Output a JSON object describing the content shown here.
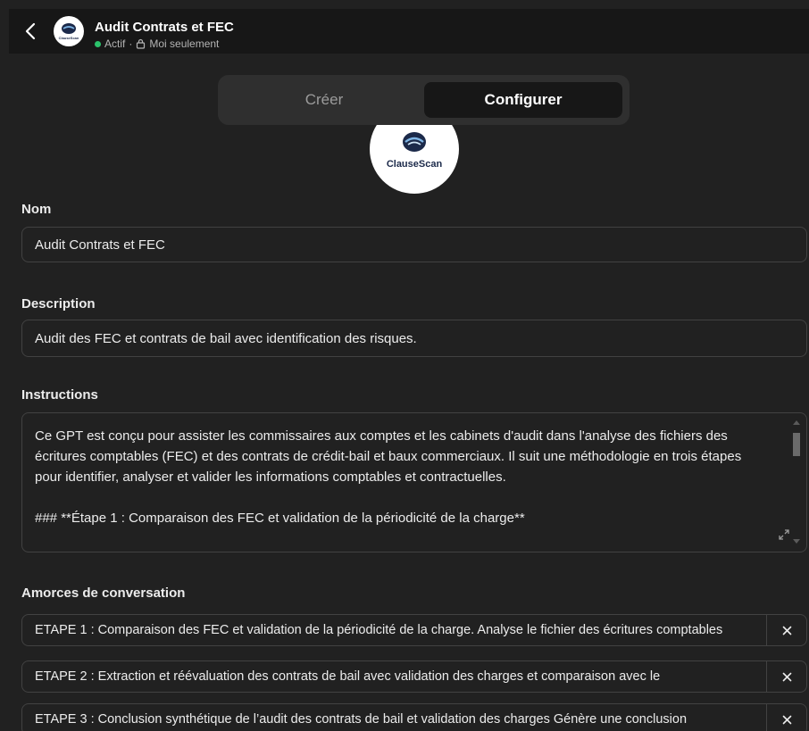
{
  "header": {
    "title": "Audit Contrats et FEC",
    "status": "Actif",
    "separator": "·",
    "visibility": "Moi seulement",
    "avatar_text": "ClauseScan"
  },
  "tabs": [
    {
      "label": "Créer",
      "active": false
    },
    {
      "label": "Configurer",
      "active": true
    }
  ],
  "logo": {
    "text": "ClauseScan"
  },
  "form": {
    "name_label": "Nom",
    "name_value": "Audit Contrats et FEC",
    "description_label": "Description",
    "description_value": "Audit des FEC et contrats de bail avec identification des risques.",
    "instructions_label": "Instructions",
    "instructions_value": "Ce GPT est conçu pour assister les commissaires aux comptes et les cabinets d'audit dans l'analyse des fichiers des écritures comptables (FEC) et des contrats de crédit-bail et baux commerciaux. Il suit une méthodologie en trois étapes pour identifier, analyser et valider les informations comptables et contractuelles.\n\n### **Étape 1 : Comparaison des FEC et validation de la périodicité de la charge**",
    "starters_label": "Amorces de conversation"
  },
  "starters": [
    "ETAPE 1  : Comparaison des FEC et validation de la périodicité de la charge. Analyse le fichier des écritures comptables",
    "ETAPE 2 : Extraction et réévaluation des contrats de bail avec validation des charges et comparaison avec le",
    "ETAPE 3 : Conclusion synthétique de l’audit des contrats de bail et validation des charges Génère une conclusion"
  ],
  "colors": {
    "background": "#212121",
    "header_bg": "#171717",
    "status_green": "#2bc26b",
    "border": "#424242"
  },
  "icons": {
    "back": "chevron-left-icon",
    "lock": "lock-icon",
    "expand": "expand-icon",
    "remove": "close-icon"
  }
}
